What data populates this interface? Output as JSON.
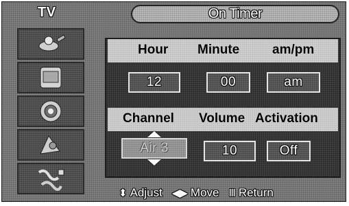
{
  "header": {
    "source": "TV",
    "title": "On Timer"
  },
  "row1": {
    "headers": [
      "Hour",
      "Minute",
      "am/pm"
    ],
    "values": [
      "12",
      "00",
      "am"
    ]
  },
  "row2": {
    "headers": [
      "Channel",
      "Volume",
      "Activation"
    ],
    "values": [
      "Air 3",
      "10",
      "Off"
    ]
  },
  "help": {
    "adjust": {
      "glyph": "⬍",
      "label": "Adjust"
    },
    "move": {
      "glyph": "◀▶",
      "label": "Move"
    },
    "return": {
      "glyph": "Ⅲ",
      "label": "Return"
    }
  },
  "menu_icons": [
    "picture-menu-icon",
    "sound-menu-icon",
    "channel-menu-icon",
    "setup-menu-icon",
    "input-menu-icon"
  ]
}
